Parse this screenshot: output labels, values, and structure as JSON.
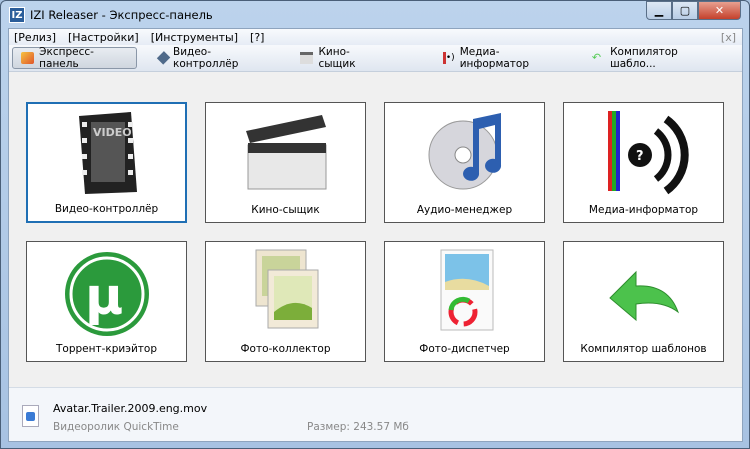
{
  "window": {
    "title": "IZI Releaser - Экспресс-панель",
    "app_icon": "IZ"
  },
  "menu": {
    "items": [
      "[Релиз]",
      "[Настройки]",
      "[Инструменты]",
      "[?]"
    ],
    "close": "[x]"
  },
  "toolbar": {
    "items": [
      {
        "label": "Экспресс-панель",
        "icon": "express-icon"
      },
      {
        "label": "Видео-контроллёр",
        "icon": "video-controller-icon"
      },
      {
        "label": "Кино-сыщик",
        "icon": "clapperboard-icon"
      },
      {
        "label": "Медиа-информатор",
        "icon": "media-info-icon"
      },
      {
        "label": "Компилятор шабло...",
        "icon": "template-arrow-icon"
      }
    ]
  },
  "tiles": [
    {
      "label": "Видео-контроллёр",
      "icon": "film-video-icon",
      "selected": true
    },
    {
      "label": "Кино-сыщик",
      "icon": "clapperboard-icon"
    },
    {
      "label": "Аудио-менеджер",
      "icon": "music-cd-icon"
    },
    {
      "label": "Медиа-информатор",
      "icon": "media-info-icon"
    },
    {
      "label": "Торрент-криэйтор",
      "icon": "utorrent-icon"
    },
    {
      "label": "Фото-коллектор",
      "icon": "photos-icon"
    },
    {
      "label": "Фото-диспетчер",
      "icon": "photo-refresh-icon"
    },
    {
      "label": "Компилятор шаблонов",
      "icon": "green-arrow-icon"
    }
  ],
  "film_text": "VIDEO",
  "status": {
    "filename": "Avatar.Trailer.2009.eng.mov",
    "type": "Видеоролик QuickTime",
    "size": "Размер: 243.57 Мб"
  }
}
